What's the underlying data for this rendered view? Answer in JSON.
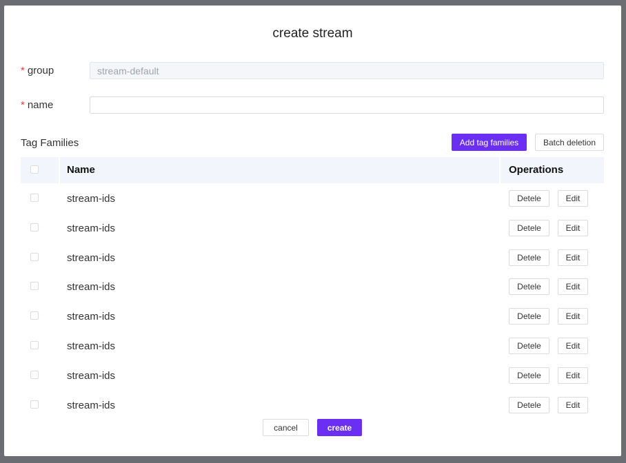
{
  "dialog": {
    "title": "create stream"
  },
  "form": {
    "group": {
      "label": "group",
      "required_mark": "*",
      "value": "stream-default"
    },
    "name": {
      "label": "name",
      "required_mark": "*",
      "value": ""
    }
  },
  "tag_families": {
    "section_label": "Tag Families",
    "add_label": "Add tag families",
    "batch_delete_label": "Batch deletion",
    "columns": [
      "Name",
      "Operations"
    ],
    "rows": [
      {
        "name": "stream-ids",
        "delete_label": "Detele",
        "edit_label": "Edit"
      },
      {
        "name": "stream-ids",
        "delete_label": "Detele",
        "edit_label": "Edit"
      },
      {
        "name": "stream-ids",
        "delete_label": "Detele",
        "edit_label": "Edit"
      },
      {
        "name": "stream-ids",
        "delete_label": "Detele",
        "edit_label": "Edit"
      },
      {
        "name": "stream-ids",
        "delete_label": "Detele",
        "edit_label": "Edit"
      },
      {
        "name": "stream-ids",
        "delete_label": "Detele",
        "edit_label": "Edit"
      },
      {
        "name": "stream-ids",
        "delete_label": "Detele",
        "edit_label": "Edit"
      },
      {
        "name": "stream-ids",
        "delete_label": "Detele",
        "edit_label": "Edit"
      }
    ]
  },
  "footer": {
    "cancel_label": "cancel",
    "create_label": "create"
  },
  "colors": {
    "primary": "#6a2ff2",
    "required": "#e0403a",
    "table_header_bg": "#f2f5fb",
    "overlay": "#6b6d72"
  }
}
